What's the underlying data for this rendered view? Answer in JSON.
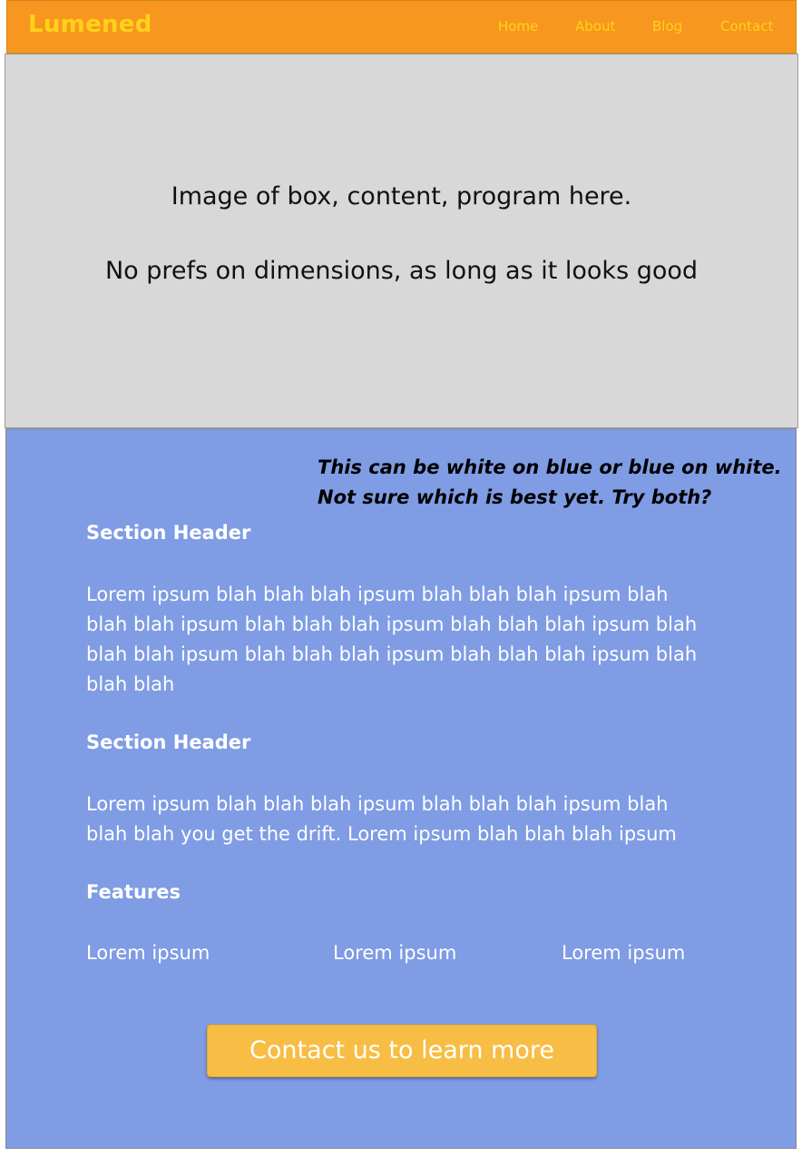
{
  "brand": {
    "name": "Lumened",
    "color": "#ffd21a"
  },
  "nav": {
    "background": "#f7971f",
    "items": [
      {
        "label": "Home"
      },
      {
        "label": "About"
      },
      {
        "label": "Blog"
      },
      {
        "label": "Contact"
      }
    ]
  },
  "hero": {
    "background": "#d8d8d8",
    "lines": [
      "Image of box, content, program here.",
      "No prefs on dimensions, as long as it looks good"
    ]
  },
  "content": {
    "background": "#7f9ce4",
    "note": [
      "This can be white on blue or blue on white.",
      "Not sure which is best yet. Try both?"
    ],
    "sections": [
      {
        "header": "Section Header",
        "body_lines": [
          "Lorem ipsum blah blah blah ipsum blah blah blah ipsum blah",
          "blah blah ipsum blah blah blah ipsum blah blah blah ipsum blah",
          "blah blah ipsum blah blah blah ipsum blah blah blah ipsum blah",
          "blah blah"
        ]
      },
      {
        "header": "Section Header",
        "body_lines": [
          "Lorem ipsum blah blah blah ipsum blah blah blah ipsum blah",
          "blah blah you get the drift. Lorem ipsum blah blah blah ipsum"
        ]
      }
    ],
    "features": {
      "header": "Features",
      "items": [
        "Lorem ipsum",
        "Lorem ipsum",
        "Lorem ipsum"
      ]
    },
    "cta": {
      "label": "Contact us to learn more",
      "color": "#f7bd44"
    }
  }
}
